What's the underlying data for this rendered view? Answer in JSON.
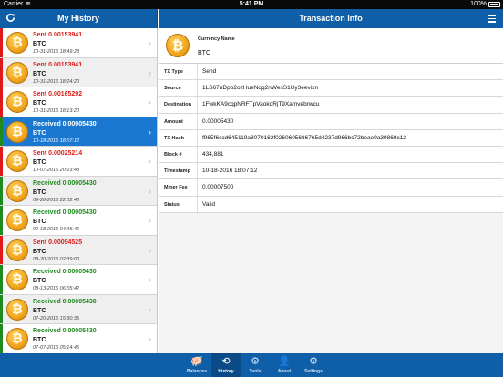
{
  "status_bar": {
    "carrier": "Carrier",
    "wifi_icon": "wifi-icon",
    "time": "5:41 PM",
    "battery": "100%"
  },
  "nav_left": {
    "title": "My History",
    "refresh_icon": "refresh-icon"
  },
  "nav_right": {
    "title": "Transaction Info",
    "list_icon": "list-icon"
  },
  "colors": {
    "nav_blue": "#0f5fa8",
    "selected_blue": "#1b78d0",
    "sent_red": "#e01a1a",
    "received_green": "#1f8a1f",
    "coin_gold": "#f1a51d"
  },
  "history": [
    {
      "type": "sent",
      "amount_text": "Sent 0.00153941",
      "currency": "BTC",
      "date": "10-31-2016 18:49:23",
      "alt": false,
      "selected": false
    },
    {
      "type": "sent",
      "amount_text": "Sent 0.00153941",
      "currency": "BTC",
      "date": "10-31-2016 18:24:20",
      "alt": true,
      "selected": false
    },
    {
      "type": "sent",
      "amount_text": "Sent 0.00165292",
      "currency": "BTC",
      "date": "10-31-2016 18:13:20",
      "alt": false,
      "selected": false
    },
    {
      "type": "received",
      "amount_text": "Received 0.00005430",
      "currency": "BTC",
      "date": "10-18-2016 18:07:12",
      "alt": false,
      "selected": true
    },
    {
      "type": "sent",
      "amount_text": "Sent 0.00025214",
      "currency": "BTC",
      "date": "10-07-2016 20:23:43",
      "alt": false,
      "selected": false
    },
    {
      "type": "received",
      "amount_text": "Received 0.00005430",
      "currency": "BTC",
      "date": "09-28-2016 22:02:48",
      "alt": true,
      "selected": false
    },
    {
      "type": "received",
      "amount_text": "Received 0.00005430",
      "currency": "BTC",
      "date": "09-18-2016 04:45:46",
      "alt": false,
      "selected": false
    },
    {
      "type": "sent",
      "amount_text": "Sent 0.00094525",
      "currency": "BTC",
      "date": "08-20-2016 02:39:00",
      "alt": true,
      "selected": false
    },
    {
      "type": "received",
      "amount_text": "Received 0.00005430",
      "currency": "BTC",
      "date": "08-13-2016 06:05:42",
      "alt": false,
      "selected": false
    },
    {
      "type": "received",
      "amount_text": "Received 0.00005430",
      "currency": "BTC",
      "date": "07-20-2016 15:30:35",
      "alt": true,
      "selected": false
    },
    {
      "type": "received",
      "amount_text": "Received 0.00005430",
      "currency": "BTC",
      "date": "07-07-2016 05:14:45",
      "alt": false,
      "selected": false
    }
  ],
  "transaction": {
    "currency_label": "Currency Name",
    "currency_value": "BTC",
    "fields": [
      {
        "label": "TX Type",
        "value": "Send"
      },
      {
        "label": "Source",
        "value": "1LS67nDpo2ozHueNqq2nWesS1Uy3eevixn"
      },
      {
        "label": "Destination",
        "value": "1FwkKA9cqpNRFTpVaokdRjT9Xamvebrwcu"
      },
      {
        "label": "Amount",
        "value": "0.00005430"
      },
      {
        "label": "TX Hash",
        "value": "f965f6ccd645119a8070162f0260605686765d4237d966bc72beae9a39869c12"
      },
      {
        "label": "Block #",
        "value": "434,881"
      },
      {
        "label": "Timestamp",
        "value": "10-18-2016 18:07:12"
      },
      {
        "label": "Miner Fee",
        "value": "0.00007500"
      },
      {
        "label": "Status",
        "value": "Valid"
      }
    ]
  },
  "tabs": [
    {
      "label": "Balances",
      "icon": "piggy-bank-icon",
      "active": false
    },
    {
      "label": "History",
      "icon": "history-icon",
      "active": true
    },
    {
      "label": "Tools",
      "icon": "gears-icon",
      "active": false
    },
    {
      "label": "About",
      "icon": "person-icon",
      "active": false
    },
    {
      "label": "Settings",
      "icon": "gear-icon",
      "active": false
    }
  ]
}
